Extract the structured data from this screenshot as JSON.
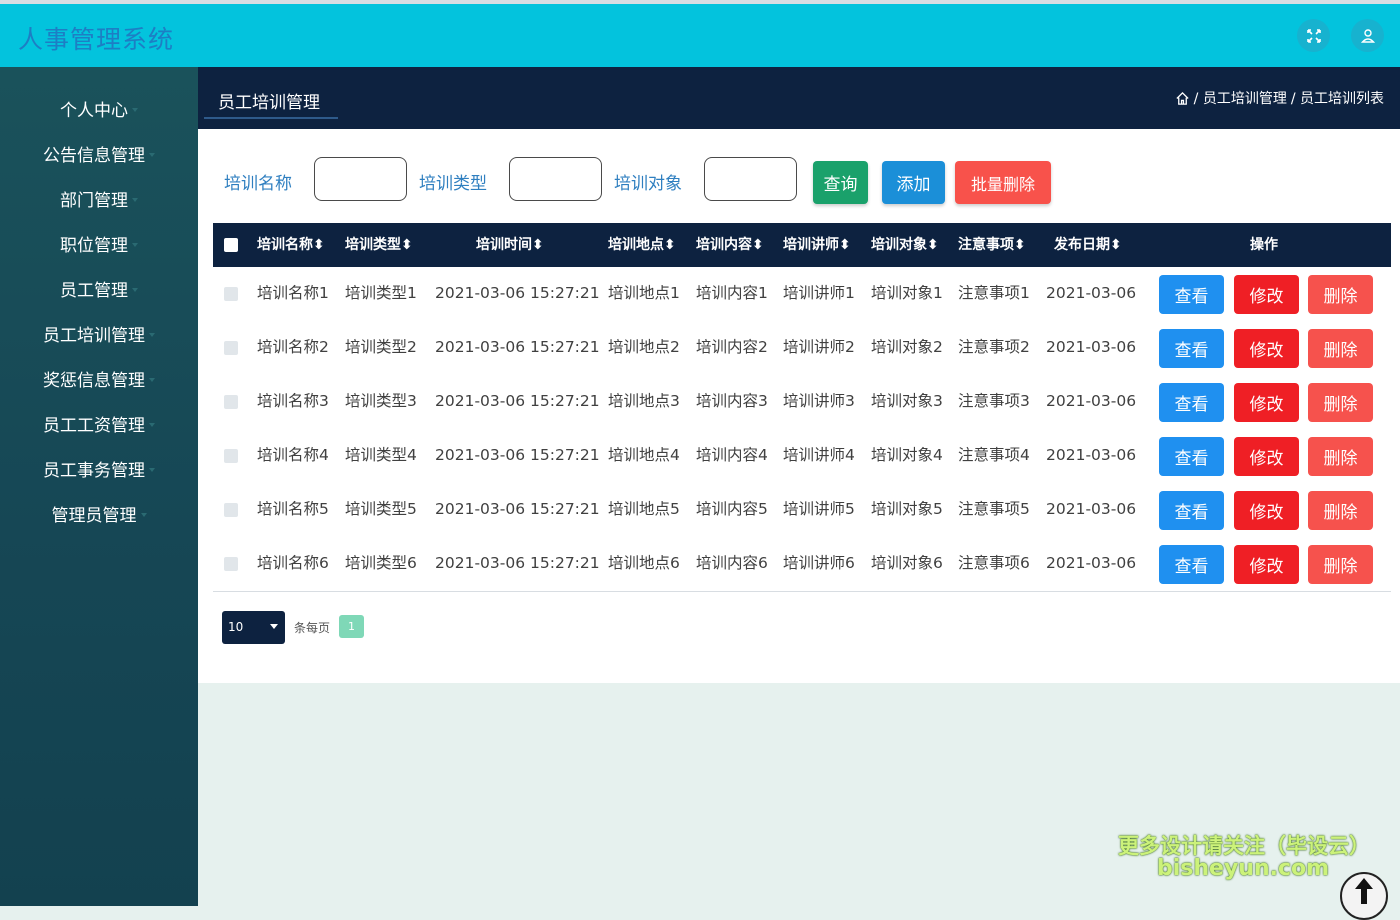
{
  "app": {
    "title": "人事管理系统"
  },
  "topbar": {
    "icons": [
      "fullscreen-icon",
      "user-icon"
    ]
  },
  "sidebar": {
    "items": [
      {
        "label": "个人中心"
      },
      {
        "label": "公告信息管理"
      },
      {
        "label": "部门管理"
      },
      {
        "label": "职位管理"
      },
      {
        "label": "员工管理"
      },
      {
        "label": "员工培训管理"
      },
      {
        "label": "奖惩信息管理"
      },
      {
        "label": "员工工资管理"
      },
      {
        "label": "员工事务管理"
      },
      {
        "label": "管理员管理"
      }
    ]
  },
  "header": {
    "page_title": "员工培训管理",
    "breadcrumb": [
      "/ 员工培训管理",
      "/ 员工培训列表"
    ]
  },
  "search": {
    "fields": [
      {
        "label": "培训名称",
        "value": ""
      },
      {
        "label": "培训类型",
        "value": ""
      },
      {
        "label": "培训对象",
        "value": ""
      }
    ],
    "query_button": "查询",
    "add_button": "添加",
    "batch_delete_button": "批量删除"
  },
  "colors": {
    "query": "#1aa16b",
    "add": "#1b8fd8",
    "batch_delete": "#f8524b",
    "view": "#1f90f0",
    "edit": "#ef1f25",
    "delete": "#f6524d",
    "header_bg": "#0d2240",
    "topbar_bg": "#03c3dd"
  },
  "table": {
    "headers": [
      "培训名称",
      "培训类型",
      "培训时间",
      "培训地点",
      "培训内容",
      "培训讲师",
      "培训对象",
      "注意事项",
      "发布日期",
      "操作"
    ],
    "sort_icon": "sort-icon",
    "actions": {
      "view": "查看",
      "edit": "修改",
      "delete": "删除"
    },
    "rows": [
      [
        "培训名称1",
        "培训类型1",
        "2021-03-06 15:27:21",
        "培训地点1",
        "培训内容1",
        "培训讲师1",
        "培训对象1",
        "注意事项1",
        "2021-03-06"
      ],
      [
        "培训名称2",
        "培训类型2",
        "2021-03-06 15:27:21",
        "培训地点2",
        "培训内容2",
        "培训讲师2",
        "培训对象2",
        "注意事项2",
        "2021-03-06"
      ],
      [
        "培训名称3",
        "培训类型3",
        "2021-03-06 15:27:21",
        "培训地点3",
        "培训内容3",
        "培训讲师3",
        "培训对象3",
        "注意事项3",
        "2021-03-06"
      ],
      [
        "培训名称4",
        "培训类型4",
        "2021-03-06 15:27:21",
        "培训地点4",
        "培训内容4",
        "培训讲师4",
        "培训对象4",
        "注意事项4",
        "2021-03-06"
      ],
      [
        "培训名称5",
        "培训类型5",
        "2021-03-06 15:27:21",
        "培训地点5",
        "培训内容5",
        "培训讲师5",
        "培训对象5",
        "注意事项5",
        "2021-03-06"
      ],
      [
        "培训名称6",
        "培训类型6",
        "2021-03-06 15:27:21",
        "培训地点6",
        "培训内容6",
        "培训讲师6",
        "培训对象6",
        "注意事项6",
        "2021-03-06"
      ]
    ]
  },
  "pagination": {
    "page_size": "10",
    "per_page_label": "条每页",
    "current_page": "1"
  },
  "watermark": {
    "line1": "更多设计请关注（毕设云）",
    "line2": "bisheyun.com"
  }
}
